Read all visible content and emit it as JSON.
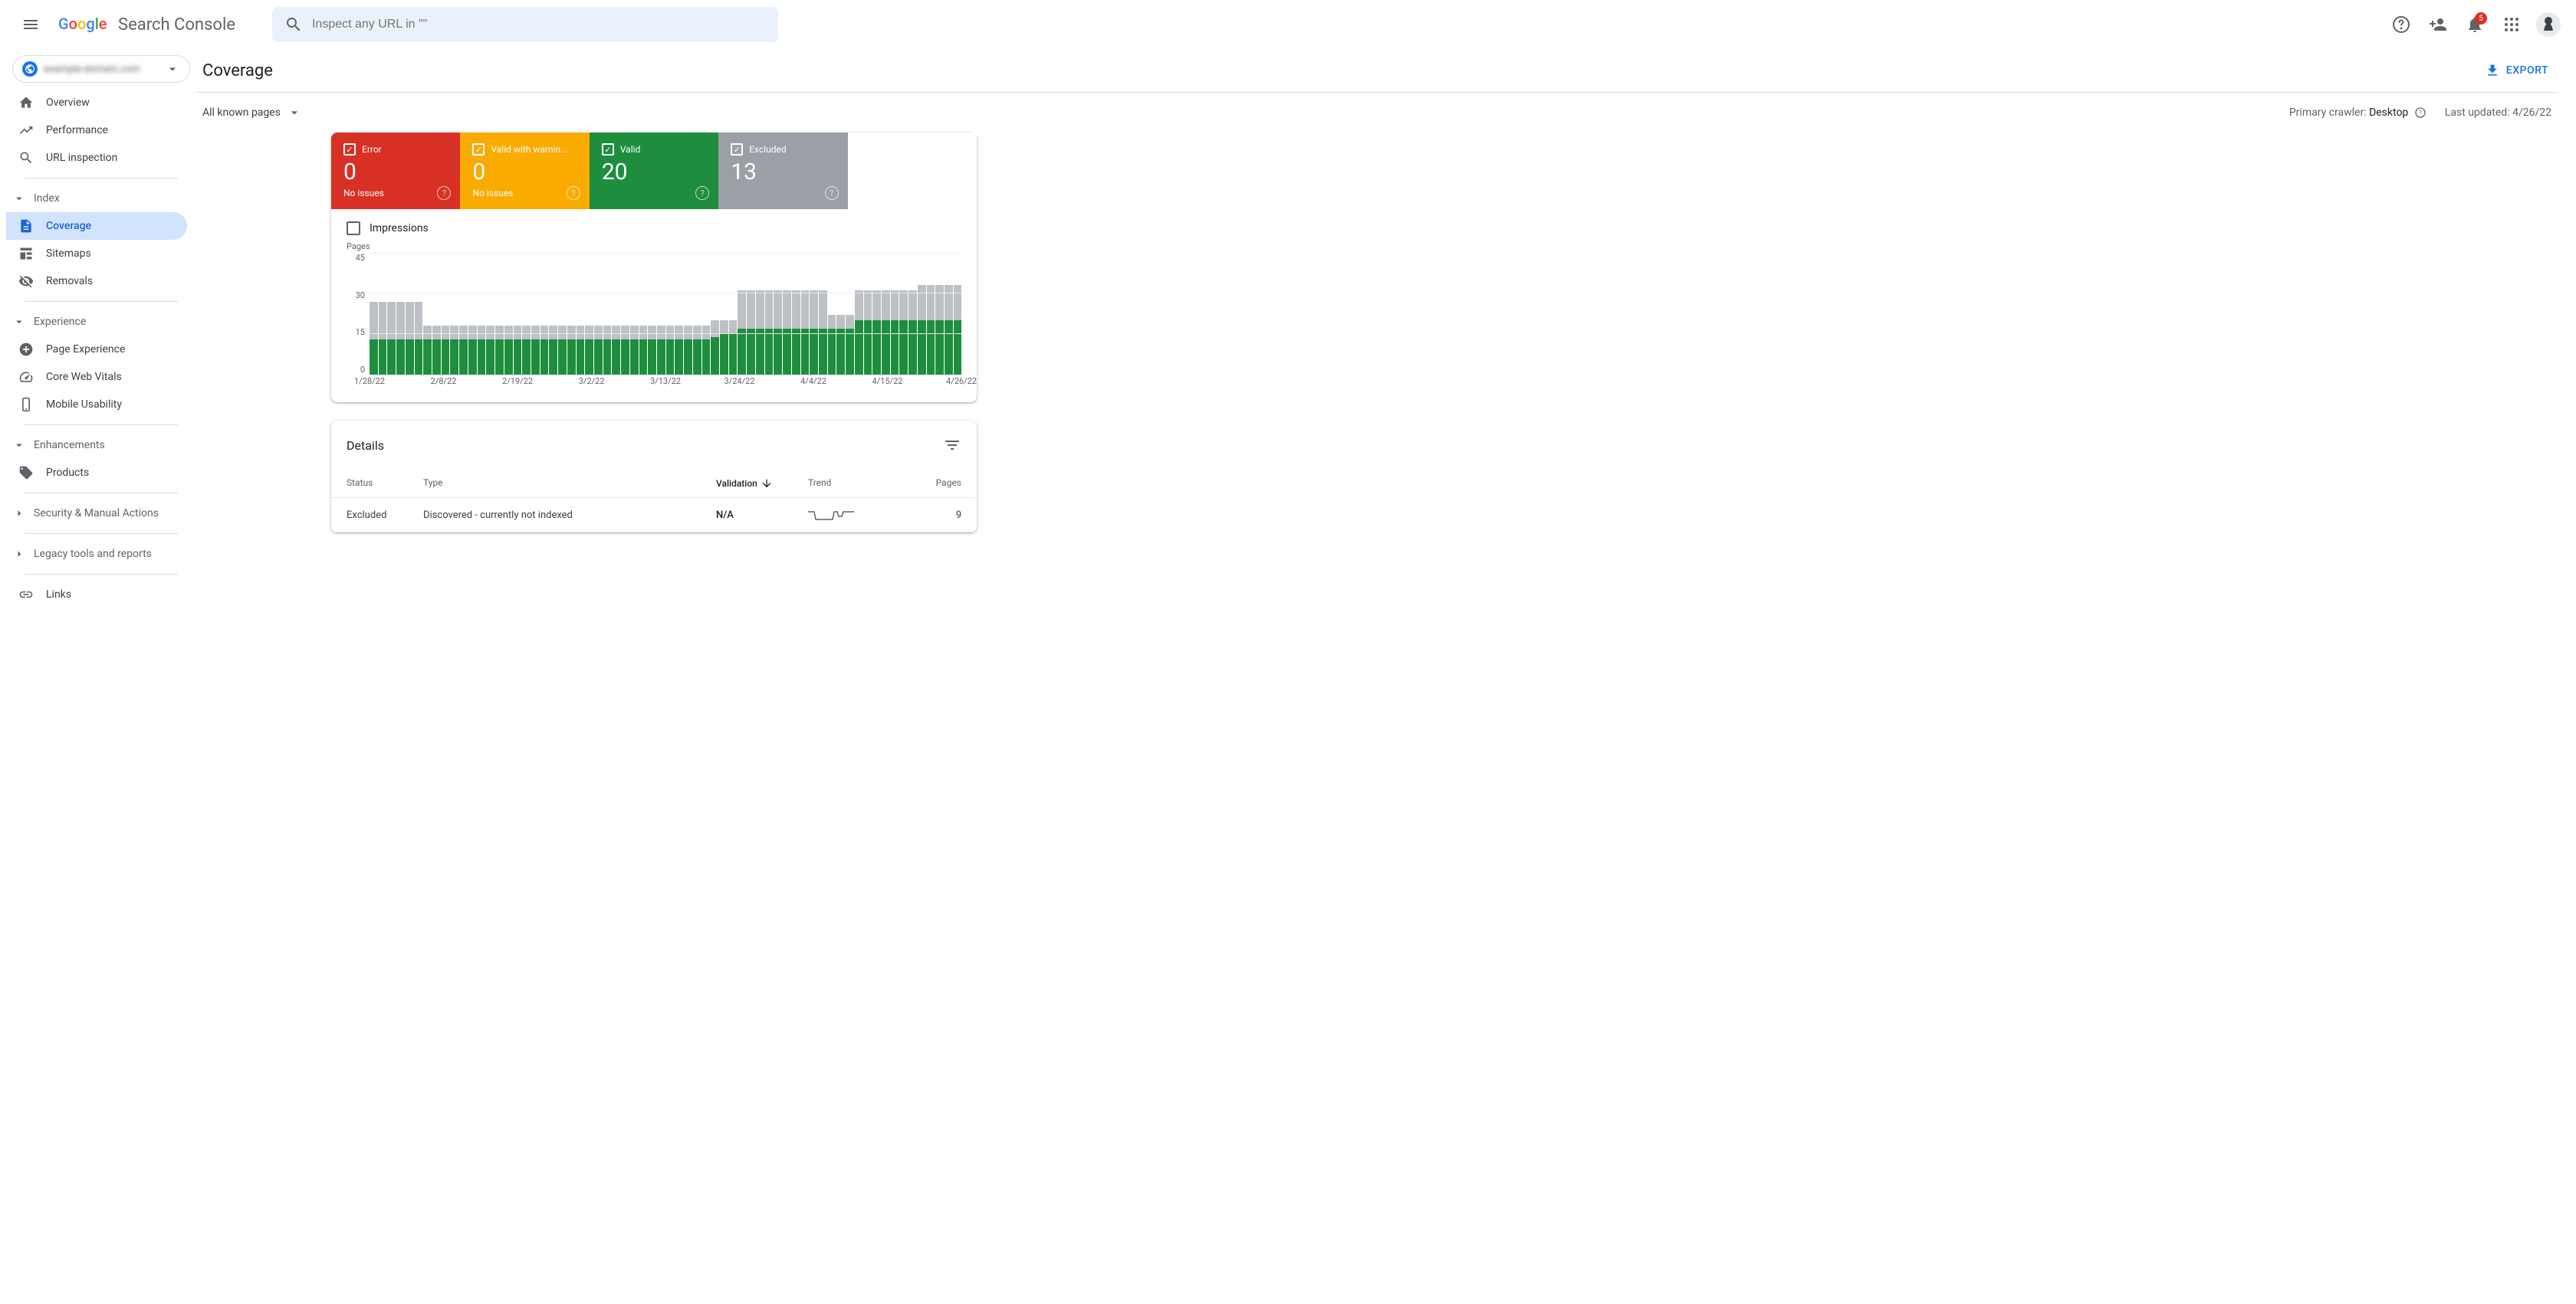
{
  "header": {
    "product_name": "Search Console",
    "search_placeholder": "Inspect any URL in \"\"",
    "notification_count": "5"
  },
  "sidebar": {
    "property_name": "example-domain.com",
    "items_top": [
      {
        "label": "Overview"
      },
      {
        "label": "Performance"
      },
      {
        "label": "URL inspection"
      }
    ],
    "section_index": "Index",
    "items_index": [
      {
        "label": "Coverage"
      },
      {
        "label": "Sitemaps"
      },
      {
        "label": "Removals"
      }
    ],
    "section_experience": "Experience",
    "items_experience": [
      {
        "label": "Page Experience"
      },
      {
        "label": "Core Web Vitals"
      },
      {
        "label": "Mobile Usability"
      }
    ],
    "section_enhancements": "Enhancements",
    "items_enhancements": [
      {
        "label": "Products"
      }
    ],
    "section_security": "Security & Manual Actions",
    "section_legacy": "Legacy tools and reports",
    "item_links": "Links"
  },
  "main": {
    "page_title": "Coverage",
    "export_label": "EXPORT",
    "filter_label": "All known pages",
    "crawler_label": "Primary crawler:",
    "crawler_value": "Desktop",
    "updated_label": "Last updated:",
    "updated_value": "4/26/22",
    "tabs": {
      "error": {
        "label": "Error",
        "value": "0",
        "sub": "No issues"
      },
      "warning": {
        "label": "Valid with warnin...",
        "value": "0",
        "sub": "No issues"
      },
      "valid": {
        "label": "Valid",
        "value": "20"
      },
      "excluded": {
        "label": "Excluded",
        "value": "13"
      }
    },
    "impressions_label": "Impressions",
    "details_title": "Details",
    "table": {
      "headers": {
        "status": "Status",
        "type": "Type",
        "validation": "Validation",
        "trend": "Trend",
        "pages": "Pages"
      },
      "rows": [
        {
          "status": "Excluded",
          "type": "Discovered - currently not indexed",
          "validation": "N/A",
          "pages": "9"
        }
      ]
    }
  },
  "chart_data": {
    "type": "bar",
    "title": "Pages",
    "ylabel": "Pages",
    "ylim": [
      0,
      45
    ],
    "yticks": [
      0,
      15,
      30,
      45
    ],
    "x_labels": [
      "1/28/22",
      "2/8/22",
      "2/19/22",
      "3/2/22",
      "3/13/22",
      "3/24/22",
      "4/4/22",
      "4/15/22",
      "4/26/22"
    ],
    "series": [
      {
        "name": "Valid",
        "color": "#1e8e3e"
      },
      {
        "name": "Excluded",
        "color": "#bdc1c6"
      }
    ],
    "stacked_values": [
      {
        "valid": 13,
        "excluded": 14
      },
      {
        "valid": 13,
        "excluded": 14
      },
      {
        "valid": 13,
        "excluded": 14
      },
      {
        "valid": 13,
        "excluded": 14
      },
      {
        "valid": 13,
        "excluded": 14
      },
      {
        "valid": 13,
        "excluded": 14
      },
      {
        "valid": 13,
        "excluded": 5
      },
      {
        "valid": 13,
        "excluded": 5
      },
      {
        "valid": 13,
        "excluded": 5
      },
      {
        "valid": 13,
        "excluded": 5
      },
      {
        "valid": 13,
        "excluded": 5
      },
      {
        "valid": 13,
        "excluded": 5
      },
      {
        "valid": 13,
        "excluded": 5
      },
      {
        "valid": 13,
        "excluded": 5
      },
      {
        "valid": 13,
        "excluded": 5
      },
      {
        "valid": 13,
        "excluded": 5
      },
      {
        "valid": 13,
        "excluded": 5
      },
      {
        "valid": 13,
        "excluded": 5
      },
      {
        "valid": 13,
        "excluded": 5
      },
      {
        "valid": 13,
        "excluded": 5
      },
      {
        "valid": 13,
        "excluded": 5
      },
      {
        "valid": 13,
        "excluded": 5
      },
      {
        "valid": 13,
        "excluded": 5
      },
      {
        "valid": 13,
        "excluded": 5
      },
      {
        "valid": 13,
        "excluded": 5
      },
      {
        "valid": 13,
        "excluded": 5
      },
      {
        "valid": 13,
        "excluded": 5
      },
      {
        "valid": 13,
        "excluded": 5
      },
      {
        "valid": 13,
        "excluded": 5
      },
      {
        "valid": 13,
        "excluded": 5
      },
      {
        "valid": 13,
        "excluded": 5
      },
      {
        "valid": 13,
        "excluded": 5
      },
      {
        "valid": 13,
        "excluded": 5
      },
      {
        "valid": 13,
        "excluded": 5
      },
      {
        "valid": 13,
        "excluded": 5
      },
      {
        "valid": 13,
        "excluded": 5
      },
      {
        "valid": 13,
        "excluded": 5
      },
      {
        "valid": 13,
        "excluded": 5
      },
      {
        "valid": 14,
        "excluded": 6
      },
      {
        "valid": 15,
        "excluded": 5
      },
      {
        "valid": 15,
        "excluded": 5
      },
      {
        "valid": 17,
        "excluded": 14
      },
      {
        "valid": 17,
        "excluded": 14
      },
      {
        "valid": 17,
        "excluded": 14
      },
      {
        "valid": 17,
        "excluded": 14
      },
      {
        "valid": 17,
        "excluded": 14
      },
      {
        "valid": 17,
        "excluded": 14
      },
      {
        "valid": 17,
        "excluded": 14
      },
      {
        "valid": 17,
        "excluded": 14
      },
      {
        "valid": 17,
        "excluded": 14
      },
      {
        "valid": 17,
        "excluded": 14
      },
      {
        "valid": 17,
        "excluded": 5
      },
      {
        "valid": 17,
        "excluded": 5
      },
      {
        "valid": 17,
        "excluded": 5
      },
      {
        "valid": 20,
        "excluded": 11
      },
      {
        "valid": 20,
        "excluded": 11
      },
      {
        "valid": 20,
        "excluded": 11
      },
      {
        "valid": 20,
        "excluded": 11
      },
      {
        "valid": 20,
        "excluded": 11
      },
      {
        "valid": 20,
        "excluded": 11
      },
      {
        "valid": 20,
        "excluded": 11
      },
      {
        "valid": 20,
        "excluded": 13
      },
      {
        "valid": 20,
        "excluded": 13
      },
      {
        "valid": 20,
        "excluded": 13
      },
      {
        "valid": 20,
        "excluded": 13
      },
      {
        "valid": 20,
        "excluded": 13
      }
    ]
  }
}
